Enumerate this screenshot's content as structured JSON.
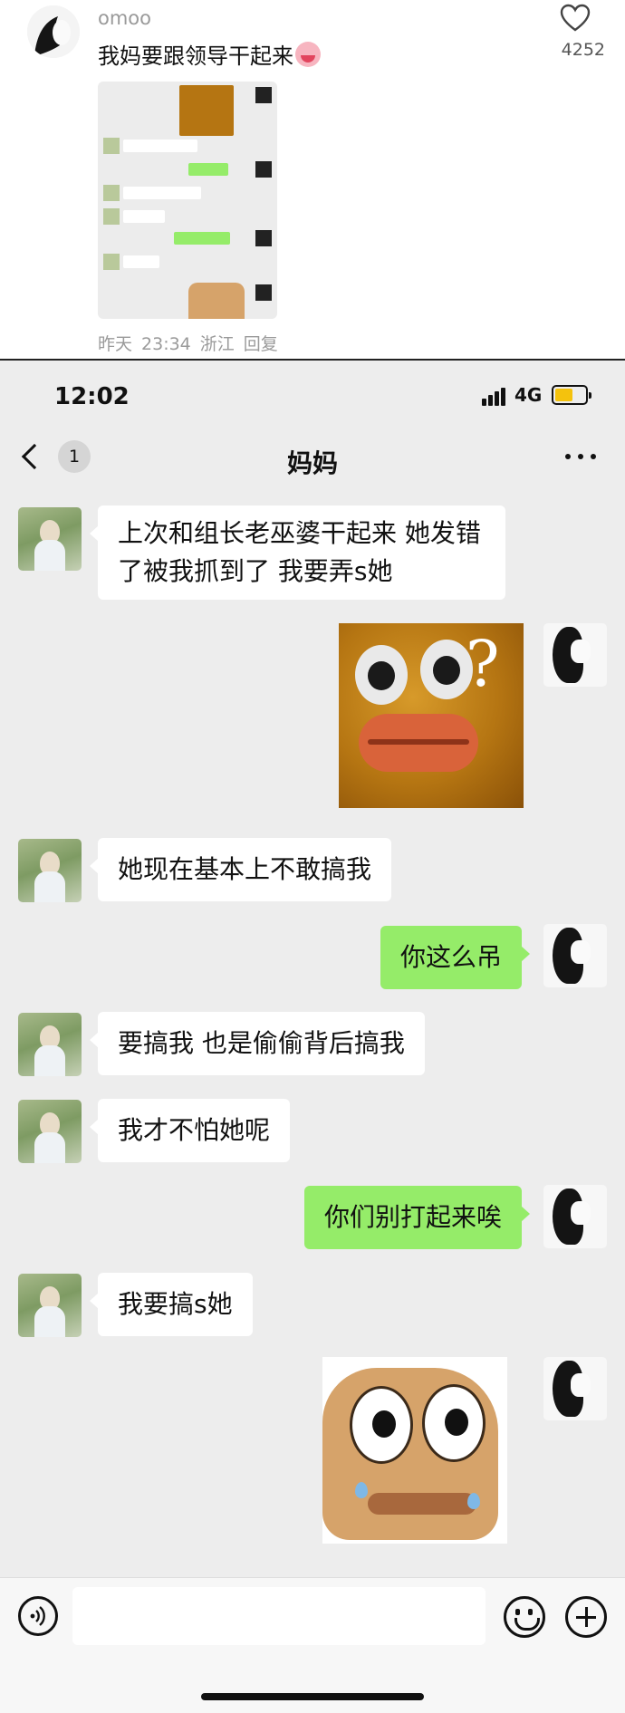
{
  "comment": {
    "username": "omoo",
    "text": "我妈要跟领导干起来",
    "emoji_icon": "crying-face-emoji-icon",
    "like_icon": "heart-outline-icon",
    "like_count": "4252",
    "meta": {
      "date": "昨天",
      "time": "23:34",
      "location": "浙江",
      "reply_label": "回复"
    }
  },
  "status_bar": {
    "time": "12:02",
    "network": "4G",
    "battery_color": "#f4c20d",
    "battery_level": 0.6
  },
  "chat": {
    "title": "妈妈",
    "unread_count": "1",
    "back_icon": "chevron-left-icon",
    "more_icon": "ellipsis-icon"
  },
  "messages": [
    {
      "from": "mom",
      "type": "text",
      "text_line1": "上次和组长老巫婆干起来 她发错",
      "text_line2": "了被我抓到了 我要弄s她"
    },
    {
      "from": "me",
      "type": "sticker",
      "sticker": "confused-fish-face-sticker"
    },
    {
      "from": "mom",
      "type": "text",
      "text": "她现在基本上不敢搞我"
    },
    {
      "from": "me",
      "type": "text",
      "text": "你这么吊"
    },
    {
      "from": "mom",
      "type": "text",
      "text": "要搞我 也是偷偷背后搞我"
    },
    {
      "from": "mom",
      "type": "text",
      "text": "我才不怕她呢"
    },
    {
      "from": "me",
      "type": "text",
      "text": "你们别打起来唉"
    },
    {
      "from": "mom",
      "type": "text",
      "text": "我要搞s她"
    },
    {
      "from": "me",
      "type": "sticker",
      "sticker": "crying-frog-face-sticker"
    }
  ],
  "colors": {
    "chat_background": "#ededed",
    "outgoing_bubble": "#95ec69",
    "incoming_bubble": "#ffffff"
  },
  "input_bar": {
    "voice_icon": "voice-input-icon",
    "emoji_icon": "smiley-icon",
    "plus_icon": "plus-circle-icon"
  }
}
